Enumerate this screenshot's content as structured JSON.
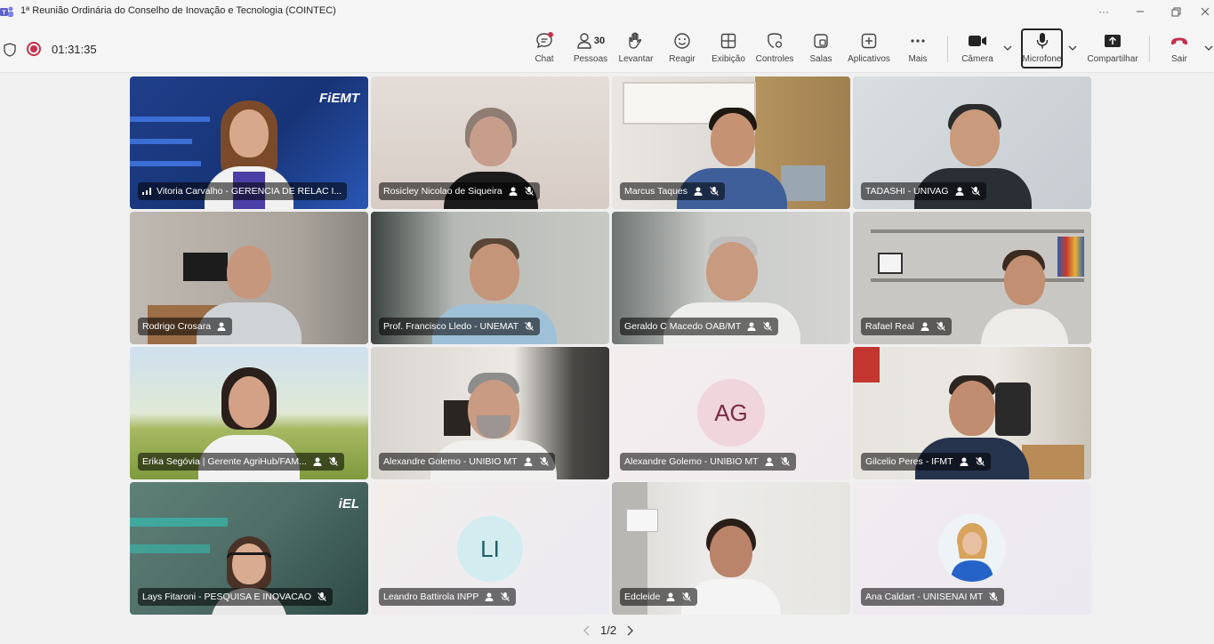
{
  "window": {
    "title": "1ª Reunião Ordinária do Conselho de Inovação e Tecnologia (COINTEC)",
    "more_glyph": "···"
  },
  "meeting": {
    "timer": "01:31:35"
  },
  "toolbar": {
    "chat": "Chat",
    "people": "Pessoas",
    "people_count": "30",
    "raise": "Levantar",
    "react": "Reagir",
    "view": "Exibição",
    "controls": "Controles",
    "rooms": "Salas",
    "apps": "Aplicativos",
    "more": "Mais",
    "camera": "Câmera",
    "microphone": "Microfone",
    "share": "Compartilhar",
    "leave": "Sair"
  },
  "participants": [
    {
      "name": "Vitoria Carvalho - GERENCIA DE RELAC I...",
      "brand": "FiEMT"
    },
    {
      "name": "Rosicley Nicolao de Siqueira"
    },
    {
      "name": "Marcus Taques"
    },
    {
      "name": "TADASHI - UNIVAG"
    },
    {
      "name": "Rodrigo Crosara"
    },
    {
      "name": "Prof. Francisco Lledo - UNEMAT"
    },
    {
      "name": "Geraldo C Macedo OAB/MT"
    },
    {
      "name": "Rafael Real"
    },
    {
      "name": "Erika Segóvia | Gerente AgriHub/FAM..."
    },
    {
      "name": "Alexandre Golemo - UNIBIO MT"
    },
    {
      "name": "Alexandre Golemo - UNIBIO MT",
      "initials": "AG"
    },
    {
      "name": "Gilcelio Peres - IFMT"
    },
    {
      "name": "Lays Fitaroni - PESQUISA E INOVACAO",
      "brand": "iEL"
    },
    {
      "name": "Leandro Battirola INPP",
      "initials": "LI"
    },
    {
      "name": "Edcleide"
    },
    {
      "name": "Ana Caldart - UNISENAI MT"
    }
  ],
  "pager": {
    "text": "1/2"
  },
  "colors": {
    "record": "#c4314b",
    "leave": "#c4314b",
    "accent": "#5b5fc7"
  }
}
